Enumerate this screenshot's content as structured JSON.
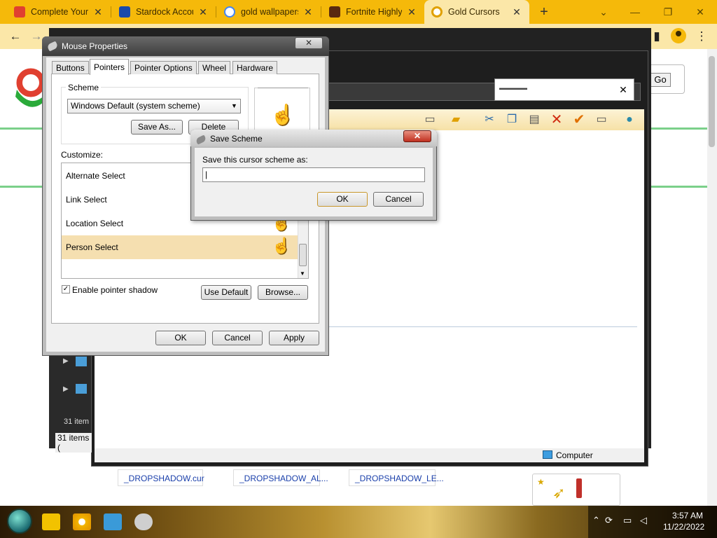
{
  "browser": {
    "tabs": [
      {
        "title": "Complete Your",
        "color": "#e04030"
      },
      {
        "title": "Stardock Accou",
        "color": "#1a4aaa"
      },
      {
        "title": "gold wallpapers",
        "color": "#4285f4"
      },
      {
        "title": "Fortnite Highly",
        "color": "#5a2a10"
      },
      {
        "title": "Gold Cursors",
        "color": "#e0a000",
        "active": true
      }
    ],
    "close_glyph": "✕",
    "new_tab_glyph": "+"
  },
  "webpage": {
    "go_label": "Go",
    "files": [
      "_DROPSHADOW.cur",
      "_DROPSHADOW_AL...",
      "_DROPSHADOW_LE..."
    ]
  },
  "explorer": {
    "items_count_1": "31 item",
    "items_count_2": "31 items (",
    "status_computer": "Computer",
    "address_text": "▬▬▬▬▬"
  },
  "mouse_properties": {
    "title": "Mouse Properties",
    "tabs": [
      "Buttons",
      "Pointers",
      "Pointer Options",
      "Wheel",
      "Hardware"
    ],
    "selected_tab": "Pointers",
    "scheme_label": "Scheme",
    "scheme_value": "Windows Default (system scheme)",
    "save_as_label": "Save As...",
    "delete_label": "Delete",
    "customize_label": "Customize:",
    "cursors": [
      "Alternate Select",
      "Link Select",
      "Location Select",
      "Person Select"
    ],
    "selected_cursor": "Person Select",
    "shadow_checkbox_label": "Enable pointer shadow",
    "shadow_checked": true,
    "use_default_label": "Use Default",
    "browse_label": "Browse...",
    "ok_label": "OK",
    "cancel_label": "Cancel",
    "apply_label": "Apply"
  },
  "save_scheme": {
    "title": "Save Scheme",
    "prompt": "Save this cursor scheme as:",
    "input_value": "|",
    "ok_label": "OK",
    "cancel_label": "Cancel"
  },
  "taskbar": {
    "time": "3:57 AM",
    "date": "11/22/2022"
  },
  "colors": {
    "chrome_tabstrip": "#f5b90a",
    "chrome_toolbar": "#fbe7a8",
    "selection": "#f5dfb0",
    "cursor_gold": "#d9a800"
  }
}
